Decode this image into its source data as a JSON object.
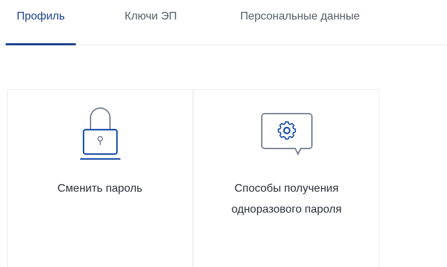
{
  "tabs": [
    {
      "label": "Профиль",
      "active": true
    },
    {
      "label": "Ключи ЭП",
      "active": false
    },
    {
      "label": "Персональные данные",
      "active": false
    }
  ],
  "cards": [
    {
      "label": "Сменить пароль",
      "icon": "lock-laptop-icon"
    },
    {
      "label_line1": "Способы получения",
      "label_line2": "одноразового пароля",
      "icon": "gear-chat-icon"
    }
  ],
  "colors": {
    "accent": "#1b3f8f",
    "icon_primary": "#1b4fa8",
    "icon_secondary": "#7d8697",
    "text": "#2b2f36",
    "tab_inactive": "#555b66"
  }
}
